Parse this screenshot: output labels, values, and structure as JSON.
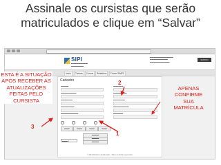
{
  "slide": {
    "title_line1": "Assinale os cursistas que serão",
    "title_line2": "matriculados e clique em “Salvar”"
  },
  "annotations": {
    "left_lines": [
      "ESTA É A SITUAÇÃO",
      "APÓS RECEBER AS",
      "ATUALIZAÇÕES",
      "FEITAS PELO",
      "CURSISTA"
    ],
    "right_lines": [
      "APENAS",
      "CONFIRME",
      "SUA",
      "MATRÍCULA"
    ],
    "marker_1": "1",
    "marker_2": "2",
    "marker_3": "3",
    "color": "#e0201b"
  },
  "screenshot": {
    "logo_text": "SIPI",
    "nav_items": [
      "Início",
      "Turmas",
      "Cursos",
      "Relatórios",
      "Fórum SIMEC"
    ],
    "page_title": "Cadastro",
    "logout_label": "SAIR DO SISTEMA",
    "footer": "© 2011 Ministério da Educação · Todos os direitos reservados"
  }
}
